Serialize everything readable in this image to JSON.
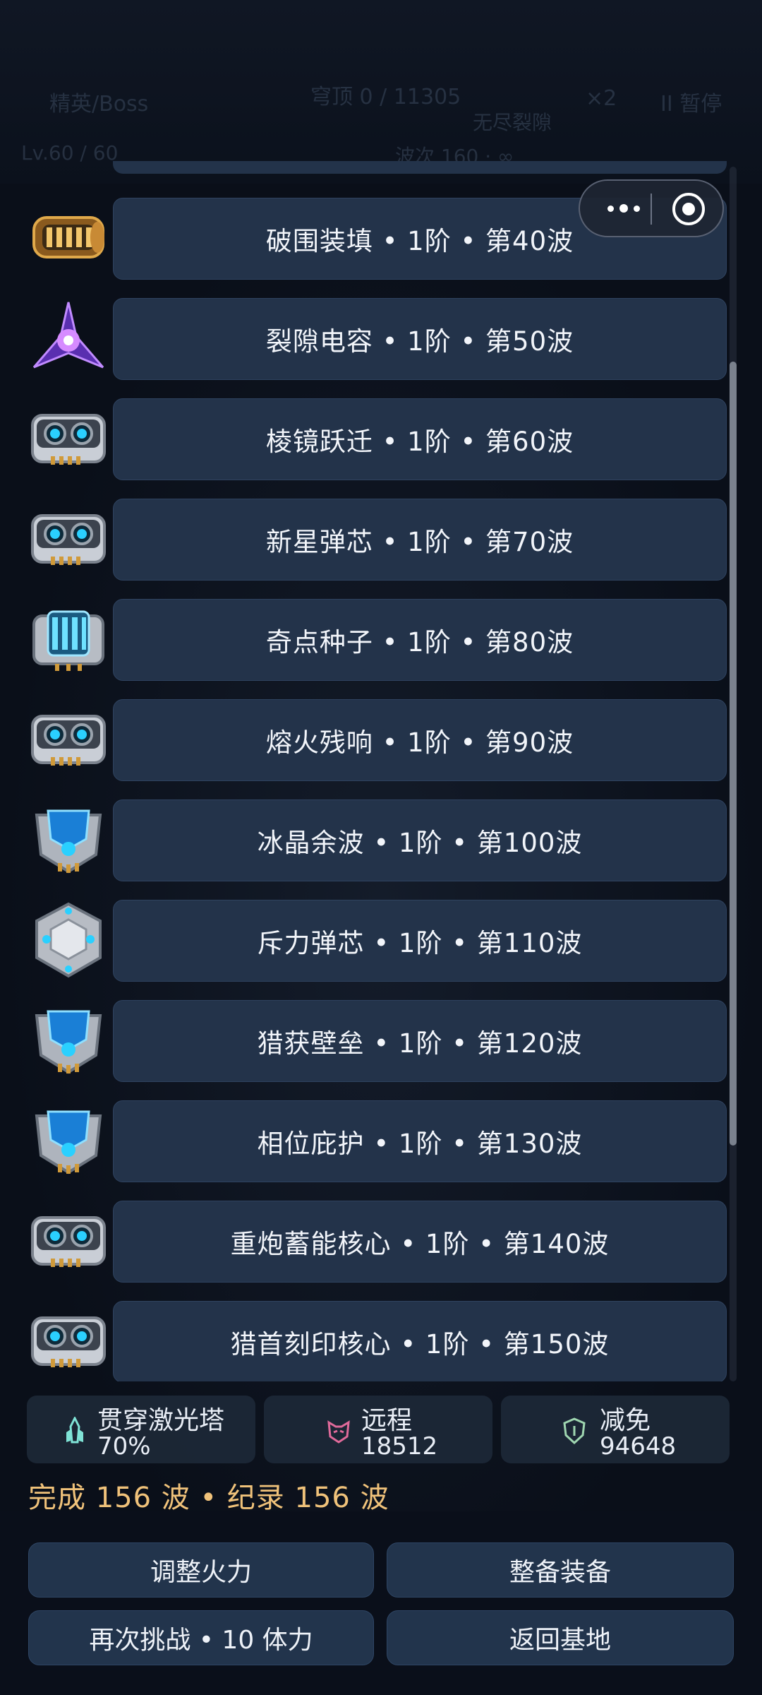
{
  "background_hud": {
    "left_label": "精英/Boss",
    "center_label": "穹顶 0 / 11305",
    "speed": "×2",
    "pause": "II 暂停",
    "mode": "无尽裂隙",
    "level": "Lv.60 / 60",
    "wave_info": "波次 160 · ∞"
  },
  "capsule": {
    "menu_icon": "more-dots-icon",
    "close_icon": "target-circle-icon"
  },
  "rewards": [
    {
      "icon": "gold-cannon-core-icon",
      "text": "破围装填 • 1阶 • 第40波"
    },
    {
      "icon": "purple-crystal-ship-icon",
      "text": "裂隙电容 • 1阶 • 第50波"
    },
    {
      "icon": "twin-lens-module-icon",
      "text": "棱镜跃迁 • 1阶 • 第60波"
    },
    {
      "icon": "twin-lens-module-icon",
      "text": "新星弹芯 • 1阶 • 第70波"
    },
    {
      "icon": "energy-cell-module-icon",
      "text": "奇点种子 • 1阶 • 第80波"
    },
    {
      "icon": "twin-lens-module-icon",
      "text": "熔火残响 • 1阶 • 第90波"
    },
    {
      "icon": "shield-module-icon",
      "text": "冰晶余波 • 1阶 • 第100波"
    },
    {
      "icon": "hex-core-module-icon",
      "text": "斥力弹芯 • 1阶 • 第110波"
    },
    {
      "icon": "shield-module-icon",
      "text": "猎获壁垒 • 1阶 • 第120波"
    },
    {
      "icon": "shield-module-icon",
      "text": "相位庇护 • 1阶 • 第130波"
    },
    {
      "icon": "twin-lens-module-icon",
      "text": "重炮蓄能核心 • 1阶 • 第140波"
    },
    {
      "icon": "twin-lens-module-icon",
      "text": "猎首刻印核心 • 1阶 • 第150波"
    }
  ],
  "stats": [
    {
      "icon": "laser-tower-icon",
      "label": "贯穿激光塔",
      "value": "70%",
      "color": "#7fe3d6"
    },
    {
      "icon": "ranged-mask-icon",
      "label": "远程",
      "value": "18512",
      "color": "#e06a9a"
    },
    {
      "icon": "shield-outline-icon",
      "label": "减免",
      "value": "94648",
      "color": "#9fd6b0"
    }
  ],
  "wave_summary": "完成 156 波 • 纪录 156 波",
  "buttons": {
    "adjust_fire": "调整火力",
    "equip": "整备装备",
    "retry": "再次挑战 • 10 体力",
    "return_base": "返回基地"
  },
  "colors": {
    "bar": "#23334a",
    "accent_gold": "#f0c27a",
    "background": "#0a0f1a"
  }
}
